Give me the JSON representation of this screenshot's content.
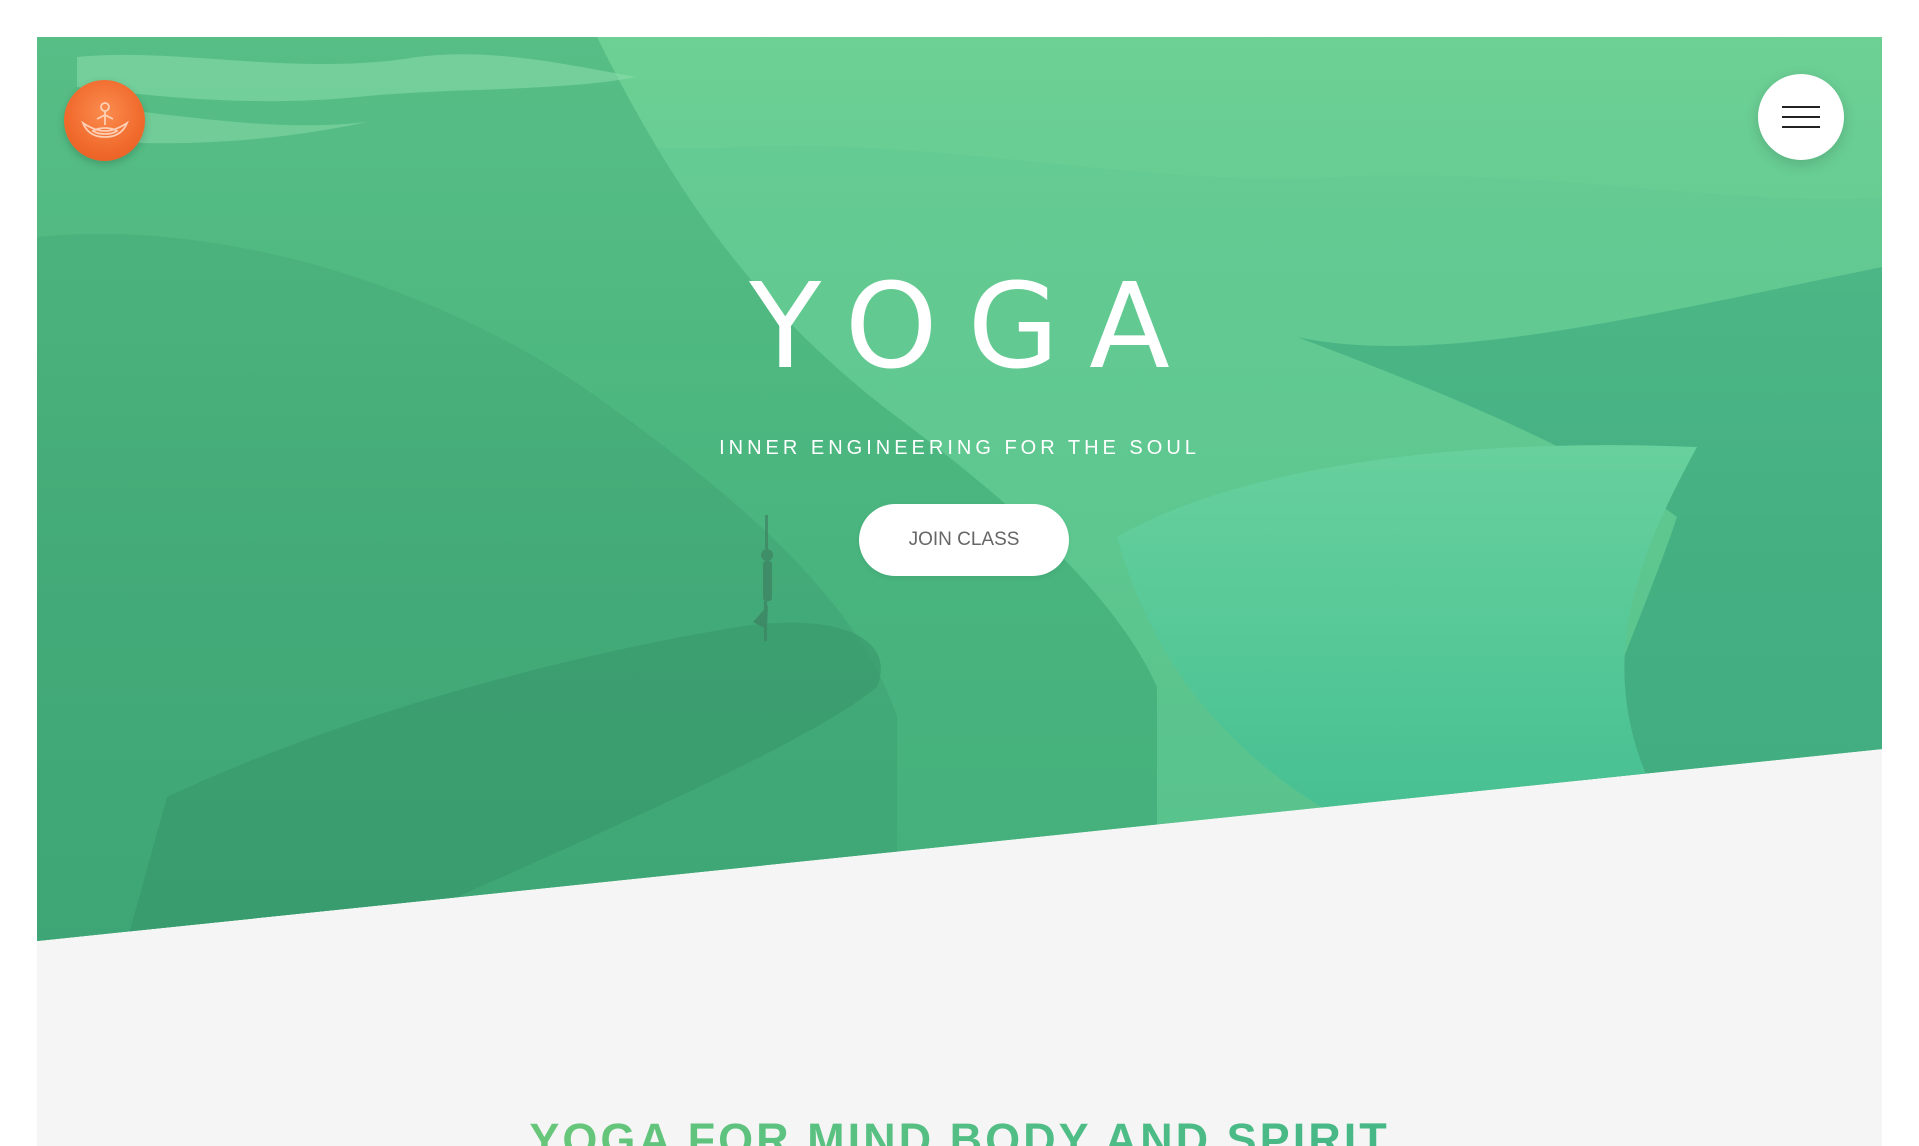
{
  "colors": {
    "hero_green": "#5ac98f",
    "logo_orange": "#f06a2c",
    "heading_gradient_start": "#7fcf6d",
    "heading_gradient_end": "#39b087",
    "page_bg": "#f5f5f5"
  },
  "header": {
    "logo_icon": "meditation-lotus-icon",
    "menu_icon": "hamburger-menu-icon"
  },
  "hero": {
    "title": "YOGA",
    "subtitle": "INNER ENGINEERING FOR THE SOUL",
    "cta_label": "JOIN CLASS"
  },
  "intro": {
    "heading": "YOGA FOR MIND,BODY AND SPIRIT"
  }
}
